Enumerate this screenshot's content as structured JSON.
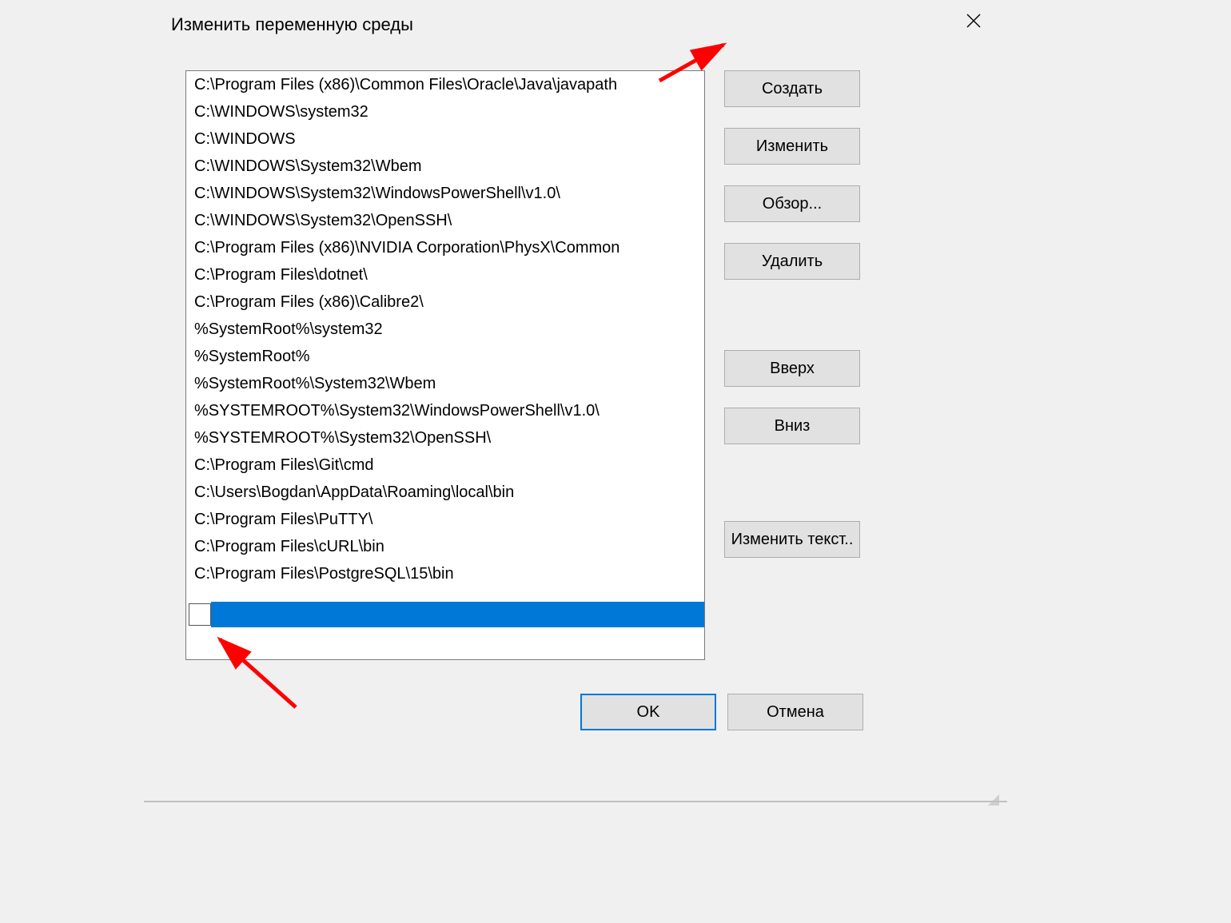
{
  "dialog": {
    "title": "Изменить переменную среды",
    "items": [
      "C:\\Program Files (x86)\\Common Files\\Oracle\\Java\\javapath",
      "C:\\WINDOWS\\system32",
      "C:\\WINDOWS",
      "C:\\WINDOWS\\System32\\Wbem",
      "C:\\WINDOWS\\System32\\WindowsPowerShell\\v1.0\\",
      "C:\\WINDOWS\\System32\\OpenSSH\\",
      "C:\\Program Files (x86)\\NVIDIA Corporation\\PhysX\\Common",
      "C:\\Program Files\\dotnet\\",
      "C:\\Program Files (x86)\\Calibre2\\",
      "%SystemRoot%\\system32",
      "%SystemRoot%",
      "%SystemRoot%\\System32\\Wbem",
      "%SYSTEMROOT%\\System32\\WindowsPowerShell\\v1.0\\",
      "%SYSTEMROOT%\\System32\\OpenSSH\\",
      "C:\\Program Files\\Git\\cmd",
      "C:\\Users\\Bogdan\\AppData\\Roaming\\local\\bin",
      "C:\\Program Files\\PuTTY\\",
      "C:\\Program Files\\cURL\\bin",
      "C:\\Program Files\\PostgreSQL\\15\\bin"
    ],
    "edit_value": "",
    "buttons": {
      "new": "Создать",
      "edit": "Изменить",
      "browse": "Обзор...",
      "delete": "Удалить",
      "up": "Вверх",
      "down": "Вниз",
      "edit_text": "Изменить текст..",
      "ok": "OK",
      "cancel": "Отмена"
    }
  },
  "annotations": {
    "arrow_color": "#ff0000"
  }
}
